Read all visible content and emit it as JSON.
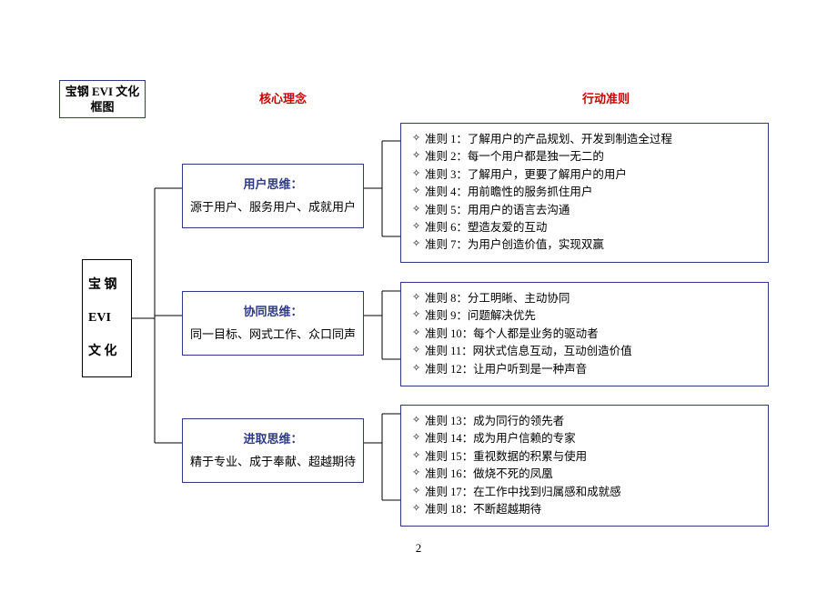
{
  "titleBox": "宝钢 EVI 文化框图",
  "headers": {
    "core": "核心理念",
    "action": "行动准则"
  },
  "root": {
    "line1": "宝 钢",
    "line2": "EVI",
    "line3": "文 化"
  },
  "concepts": [
    {
      "title": "用户思维：",
      "desc": "源于用户、服务用户、成就用户"
    },
    {
      "title": "协同思维：",
      "desc": "同一目标、网式工作、众口同声"
    },
    {
      "title": "进取思维：",
      "desc": "精于专业、成于奉献、超越期待"
    }
  ],
  "rulesGroups": [
    [
      "准则 1：了解用户的产品规划、开发到制造全过程",
      "准则 2：每一个用户都是独一无二的",
      "准则 3：了解用户，更要了解用户的用户",
      "准则 4：用前瞻性的服务抓住用户",
      "准则 5：用用户的语言去沟通",
      "准则 6：塑造友爱的互动",
      "准则 7：为用户创造价值，实现双赢"
    ],
    [
      "准则 8：分工明晰、主动协同",
      "准则 9：问题解决优先",
      "准则 10：每个人都是业务的驱动者",
      "准则 11：网状式信息互动，互动创造价值",
      "准则 12：让用户听到是一种声音"
    ],
    [
      "准则 13：成为同行的领先者",
      "准则 14：成为用户信赖的专家",
      "准则 15：重视数据的积累与使用",
      "准则 16：做烧不死的凤凰",
      "准则 17：在工作中找到归属感和成就感",
      "准则 18：不断超越期待"
    ]
  ],
  "pageNumber": "2"
}
